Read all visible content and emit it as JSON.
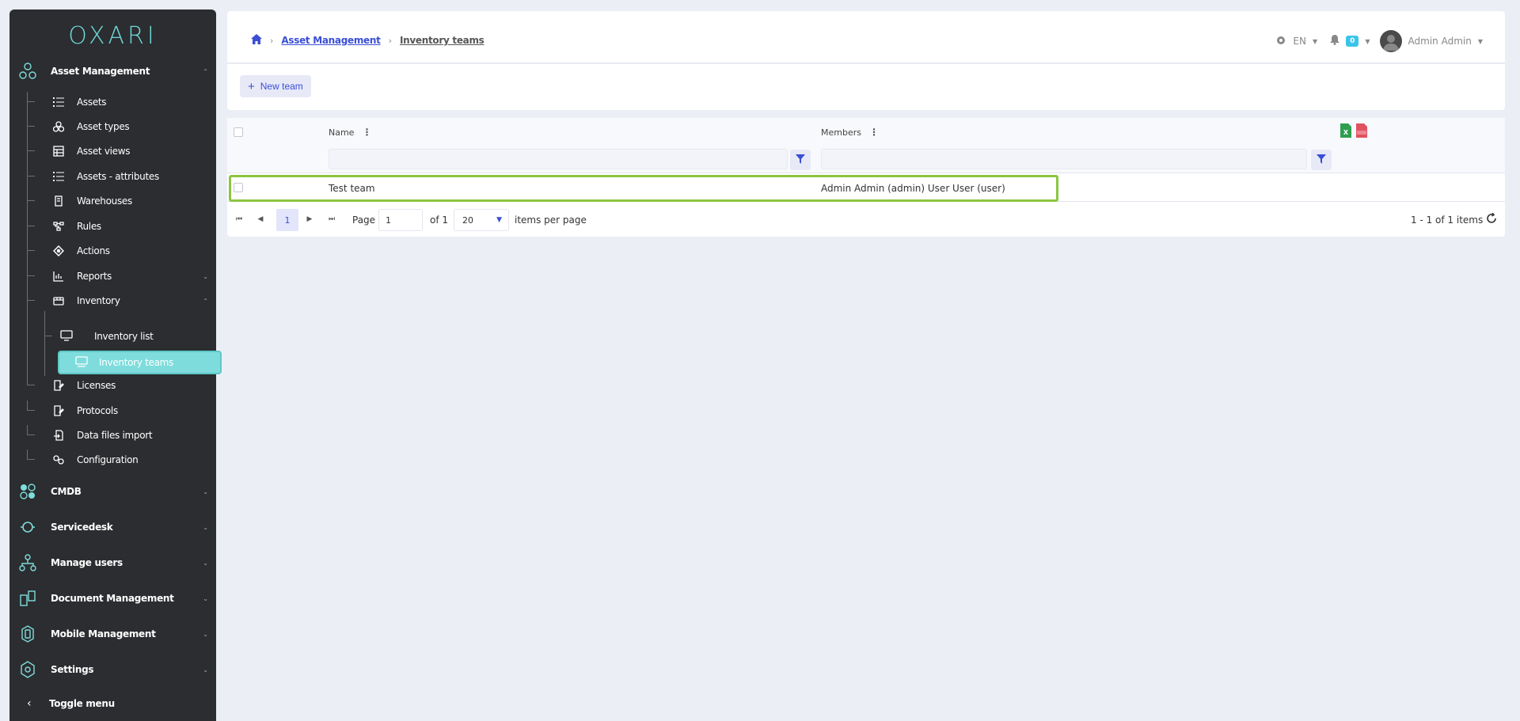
{
  "logo": "OXARI",
  "sidebar": {
    "sections": [
      {
        "label": "Asset Management",
        "icon": "hexagon-nodes-icon",
        "chevron": "⌃"
      },
      {
        "label": "CMDB",
        "icon": "hex-cluster-icon",
        "chevron": "⌄"
      },
      {
        "label": "Servicedesk",
        "icon": "headset-icon",
        "chevron": "⌄"
      },
      {
        "label": "Manage users",
        "icon": "user-tree-icon",
        "chevron": "⌄"
      },
      {
        "label": "Document Management",
        "icon": "documents-icon",
        "chevron": "⌄"
      },
      {
        "label": "Mobile Management",
        "icon": "mobile-icon",
        "chevron": "⌄"
      },
      {
        "label": "Settings",
        "icon": "cog-hex-icon",
        "chevron": "⌄"
      }
    ],
    "items": [
      {
        "label": "Assets",
        "icon": "list-icon"
      },
      {
        "label": "Asset types",
        "icon": "shapes-icon"
      },
      {
        "label": "Asset views",
        "icon": "table-icon"
      },
      {
        "label": "Assets - attributes",
        "icon": "list-icon"
      },
      {
        "label": "Warehouses",
        "icon": "building-icon"
      },
      {
        "label": "Rules",
        "icon": "flow-icon"
      },
      {
        "label": "Actions",
        "icon": "diamond-icon"
      },
      {
        "label": "Reports",
        "icon": "chart-icon",
        "chevron": "⌄"
      },
      {
        "label": "Inventory",
        "icon": "inventory-icon",
        "chevron": "⌃"
      },
      {
        "label": "Licenses",
        "icon": "license-icon"
      },
      {
        "label": "Protocols",
        "icon": "protocol-icon"
      },
      {
        "label": "Data files import",
        "icon": "file-import-icon"
      },
      {
        "label": "Configuration",
        "icon": "gears-icon"
      }
    ],
    "inventory_sub": [
      {
        "label": "Inventory list",
        "icon": "monitor-icon"
      },
      {
        "label": "Inventory teams",
        "icon": "team-icon"
      }
    ],
    "toggle": "Toggle menu"
  },
  "breadcrumb": {
    "level1": "Asset Management",
    "level2": "Inventory teams"
  },
  "header": {
    "lang": "EN",
    "notifications": "0",
    "user": "Admin Admin"
  },
  "toolbar": {
    "new_label": "New team"
  },
  "grid": {
    "columns": [
      "Name",
      "Members"
    ],
    "rows": [
      {
        "name": "Test team",
        "members": "Admin Admin (admin) User User (user)"
      }
    ]
  },
  "pager": {
    "current": "1",
    "page_label": "Page",
    "page_value": "1",
    "of_label": "of 1",
    "per_page": "20",
    "per_page_label": "items per page",
    "summary": "1 - 1 of 1 items"
  },
  "colors": {
    "accent": "#3a4ed6",
    "teal": "#7fdcdc",
    "highlight": "#8bc53f",
    "sidebar": "#2b2d30"
  }
}
